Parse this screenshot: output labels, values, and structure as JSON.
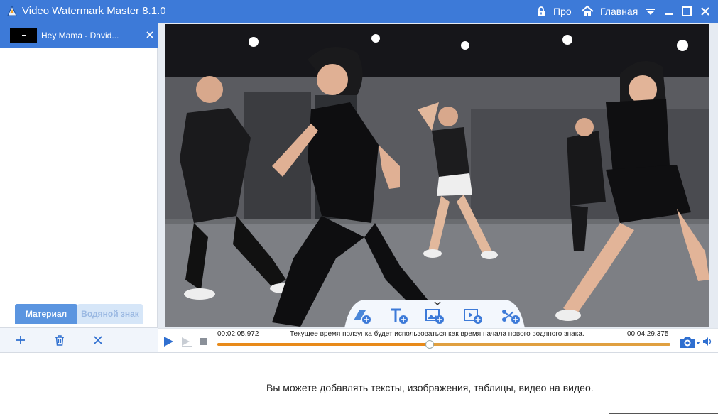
{
  "app": {
    "title": "Video Watermark Master 8.1.0",
    "pro_label": "Про",
    "home_label": "Главная",
    "accent_color": "#3d7ad8"
  },
  "file_tab": {
    "name": "Hey Mama - David..."
  },
  "panel_tabs": {
    "material": "Материал",
    "watermark": "Водяной знак"
  },
  "watermark_toolbar": {
    "buttons": [
      "add-shape-icon",
      "add-text-icon",
      "add-image-icon",
      "add-video-icon",
      "add-effect-icon"
    ]
  },
  "playback": {
    "current_time": "00:02:05.972",
    "total_time": "00:04:29.375",
    "hint": "Текущее время ползунка будет использоваться как время начала нового водяного знака.",
    "progress": 0.468
  },
  "bottom": {
    "hint": "Вы можете добавлять тексты, изображения, таблицы, видео на видео."
  }
}
